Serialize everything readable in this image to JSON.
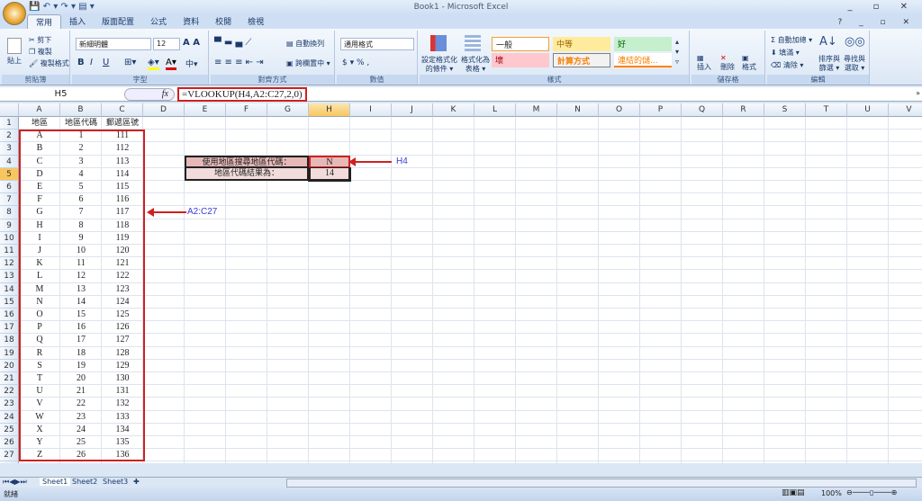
{
  "window": {
    "title": "Book1 - Microsoft Excel",
    "controls": "_ ▫ ✕"
  },
  "qat": "💾 ↶ ▾ ↷ ▾ ▤ ▾",
  "tabs": [
    "常用",
    "插入",
    "版面配置",
    "公式",
    "資料",
    "校閱",
    "檢視"
  ],
  "ribbon": {
    "clipboard": {
      "paste": "貼上",
      "cut": "剪下",
      "copy": "複製",
      "format_painter": "複製格式",
      "label": "剪貼簿"
    },
    "font": {
      "name": "新細明體",
      "size": "12",
      "bold": "B",
      "italic": "I",
      "underline": "U",
      "label": "字型"
    },
    "alignment": {
      "wrap": "自動換列",
      "merge": "跨欄置中 ▾",
      "label": "對齊方式"
    },
    "number": {
      "format": "通用格式",
      "currency": "$ ▾ % ,",
      "label": "數值"
    },
    "styles": {
      "conditional": "設定格式化的條件 ▾",
      "as_table": "格式化為表格 ▾",
      "cells": [
        "一般",
        "中等",
        "好",
        "壞",
        "計算方式",
        "連結的儲..."
      ],
      "label": "樣式"
    },
    "cells": {
      "insert": "插入",
      "delete": "刪除",
      "format": "格式",
      "label": "儲存格"
    },
    "editing": {
      "autosum": "Σ 自動加總 ▾",
      "fill": "填滿 ▾",
      "clear": "清除 ▾",
      "sort": "排序與篩選 ▾",
      "find": "尋找與選取 ▾",
      "label": "編輯"
    }
  },
  "formula_bar": {
    "name_box": "H5",
    "fx": "fx",
    "formula": "=VLOOKUP(H4,A2:C27,2,0)"
  },
  "columns": [
    "A",
    "B",
    "C",
    "D",
    "E",
    "F",
    "G",
    "H",
    "I",
    "J",
    "K",
    "L",
    "M",
    "N",
    "O",
    "P",
    "Q",
    "R",
    "S",
    "T",
    "U",
    "V"
  ],
  "rows": 28,
  "table": {
    "headers": [
      "地區",
      "地區代碼",
      "郵遞區號"
    ],
    "rows": [
      [
        "A",
        "1",
        "111"
      ],
      [
        "B",
        "2",
        "112"
      ],
      [
        "C",
        "3",
        "113"
      ],
      [
        "D",
        "4",
        "114"
      ],
      [
        "E",
        "5",
        "115"
      ],
      [
        "F",
        "6",
        "116"
      ],
      [
        "G",
        "7",
        "117"
      ],
      [
        "H",
        "8",
        "118"
      ],
      [
        "I",
        "9",
        "119"
      ],
      [
        "J",
        "10",
        "120"
      ],
      [
        "K",
        "11",
        "121"
      ],
      [
        "L",
        "12",
        "122"
      ],
      [
        "M",
        "13",
        "123"
      ],
      [
        "N",
        "14",
        "124"
      ],
      [
        "O",
        "15",
        "125"
      ],
      [
        "P",
        "16",
        "126"
      ],
      [
        "Q",
        "17",
        "127"
      ],
      [
        "R",
        "18",
        "128"
      ],
      [
        "S",
        "19",
        "129"
      ],
      [
        "T",
        "20",
        "130"
      ],
      [
        "U",
        "21",
        "131"
      ],
      [
        "V",
        "22",
        "132"
      ],
      [
        "W",
        "23",
        "133"
      ],
      [
        "X",
        "24",
        "134"
      ],
      [
        "Y",
        "25",
        "135"
      ],
      [
        "Z",
        "26",
        "136"
      ]
    ]
  },
  "lookup": {
    "label1": "使用地區搜尋地區代碼：",
    "value1": "N",
    "label2": "地區代碼結果為：",
    "value2": "14"
  },
  "annotations": {
    "h4": "H4",
    "range": "A2:C27"
  },
  "sheets": [
    "Sheet1",
    "Sheet2",
    "Sheet3"
  ],
  "status": {
    "text": "就緒",
    "zoom": "100%"
  },
  "colors": {
    "accent_red": "#d02020",
    "lookup_fill": "#e6b8b7",
    "annotation_blue": "#3b3bd6"
  }
}
